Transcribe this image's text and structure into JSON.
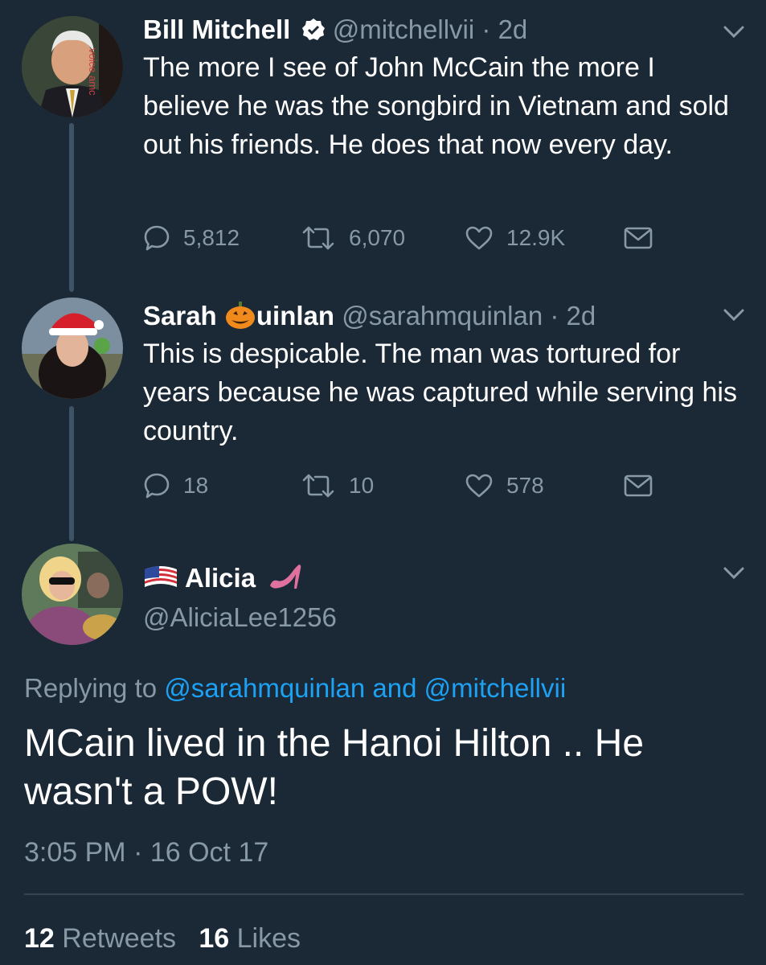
{
  "colors": {
    "background": "#1b2836",
    "text_primary": "#ffffff",
    "text_secondary": "#8899a6",
    "link": "#1da1f2",
    "thread_line": "#3d5466",
    "heart_shoe": "#e0719f"
  },
  "tweets": [
    {
      "name": "Bill Mitchell",
      "verified": true,
      "handle": "@mitchellvii",
      "sep": "·",
      "time": "2d",
      "text": "The more I see of John McCain the more I believe he was the songbird in Vietnam and sold out his friends. He does that now every day.",
      "avatar_text": "voice amc",
      "replies": "5,812",
      "retweets": "6,070",
      "likes": "12.9K",
      "icons": [
        "reply-icon",
        "retweet-icon",
        "like-icon",
        "message-icon",
        "chevron-down-icon",
        "verified-icon"
      ]
    },
    {
      "name_part1": "Sarah ",
      "name_part2": "uinlan",
      "name_emoji": "pumpkin-icon",
      "handle": "@sarahmquinlan",
      "sep": "·",
      "time": "2d",
      "text": "This is despicable. The man was tortured for years because he was captured while serving his country.",
      "replies": "18",
      "retweets": "10",
      "likes": "578"
    }
  ],
  "main_tweet": {
    "name": "Alicia",
    "name_prefix_icon": "us-flag-icon",
    "name_suffix_icon": "high-heel-icon",
    "handle": "@AliciaLee1256",
    "replying_to_label": "Replying to",
    "mention1": "@sarahmquinlan",
    "and_word": "and",
    "mention2": "@mitchellvii",
    "text": "MCain lived in the Hanoi Hilton .. He wasn't a POW!",
    "timestamp": "3:05 PM · 16 Oct 17",
    "retweets_count": "12",
    "retweets_label": "Retweets",
    "likes_count": "16",
    "likes_label": "Likes"
  }
}
